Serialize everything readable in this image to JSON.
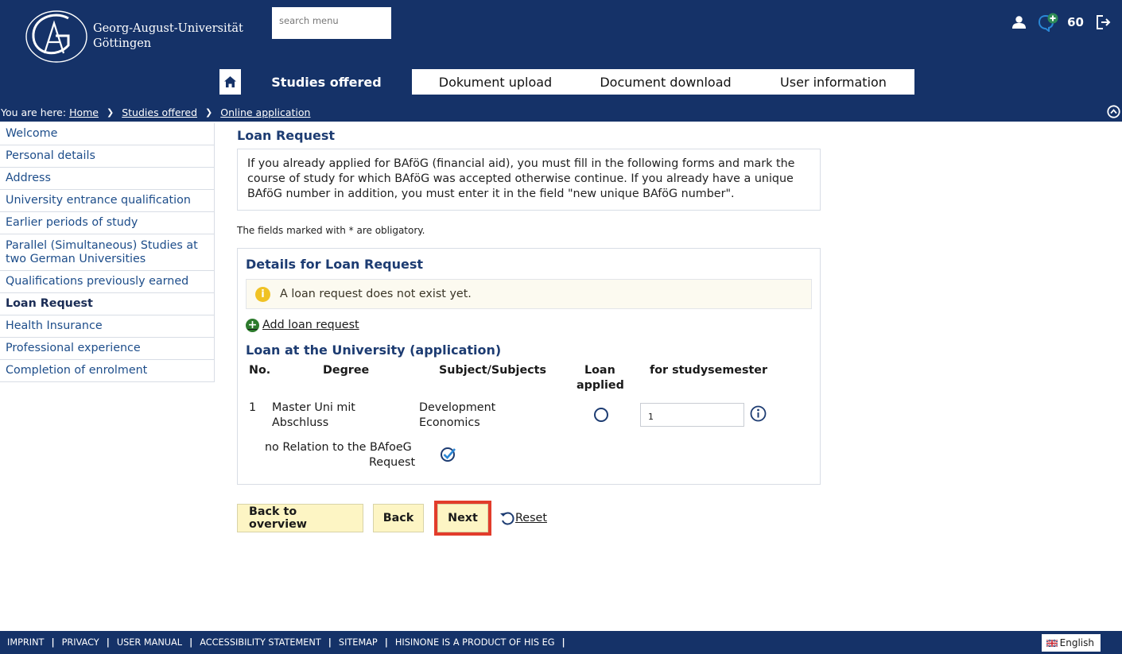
{
  "header": {
    "university_line1": "Georg-August-Universität",
    "university_line2": "Göttingen",
    "search_placeholder": "search menu",
    "notification_count": "60"
  },
  "nav": {
    "tabs": [
      {
        "label": "Studies offered",
        "active": true
      },
      {
        "label": "Dokument upload"
      },
      {
        "label": "Document download"
      },
      {
        "label": "User information"
      }
    ]
  },
  "breadcrumb": {
    "prefix": "You are here:",
    "items": [
      "Home",
      "Studies offered",
      "Online application"
    ]
  },
  "sidebar": {
    "items": [
      {
        "label": "Welcome"
      },
      {
        "label": "Personal details"
      },
      {
        "label": "Address"
      },
      {
        "label": "University entrance qualification"
      },
      {
        "label": "Earlier periods of study"
      },
      {
        "label": "Parallel (Simultaneous) Studies at two German Universities"
      },
      {
        "label": "Qualifications previously earned"
      },
      {
        "label": "Loan Request",
        "active": true
      },
      {
        "label": "Health Insurance"
      },
      {
        "label": "Professional experience"
      },
      {
        "label": "Completion of enrolment"
      }
    ]
  },
  "main": {
    "title": "Loan Request",
    "info_text": "If you already applied for BAföG (financial aid), you must fill in the following forms and mark the course of study for which BAföG was accepted otherwise continue. If you already have a unique BAföG number in addition, you must enter it in the field \"new unique BAföG number\".",
    "obligatory_note": "The fields marked with * are obligatory.",
    "panel_title": "Details for Loan Request",
    "alert_text": "A loan request does not exist yet.",
    "add_link": "Add loan request",
    "table_title": "Loan at the University (application)",
    "columns": {
      "no": "No.",
      "degree": "Degree",
      "subject": "Subject/Subjects",
      "loan_line1": "Loan",
      "loan_line2": "applied",
      "semester": "for studysemester"
    },
    "row": {
      "no": "1",
      "degree_line1": "Master Uni mit",
      "degree_line2": "Abschluss",
      "subject_line1": "Development",
      "subject_line2": "Economics",
      "semester_value": "1",
      "relation_line1": "no Relation to the BAfoeG",
      "relation_line2": "Request"
    }
  },
  "actions": {
    "back_overview": "Back to overview",
    "back": "Back",
    "next": "Next",
    "reset": "Reset"
  },
  "footer": {
    "links": [
      "IMPRINT",
      "PRIVACY",
      "USER MANUAL",
      "ACCESSIBILITY STATEMENT",
      "SITEMAP",
      "HISINONE IS A PRODUCT OF HIS EG"
    ],
    "language": "English"
  },
  "colors": {
    "brand_blue": "#153268",
    "heading_blue": "#1d3c72",
    "button_yellow": "#fdf5c4",
    "highlight_red": "#e23c2b"
  }
}
